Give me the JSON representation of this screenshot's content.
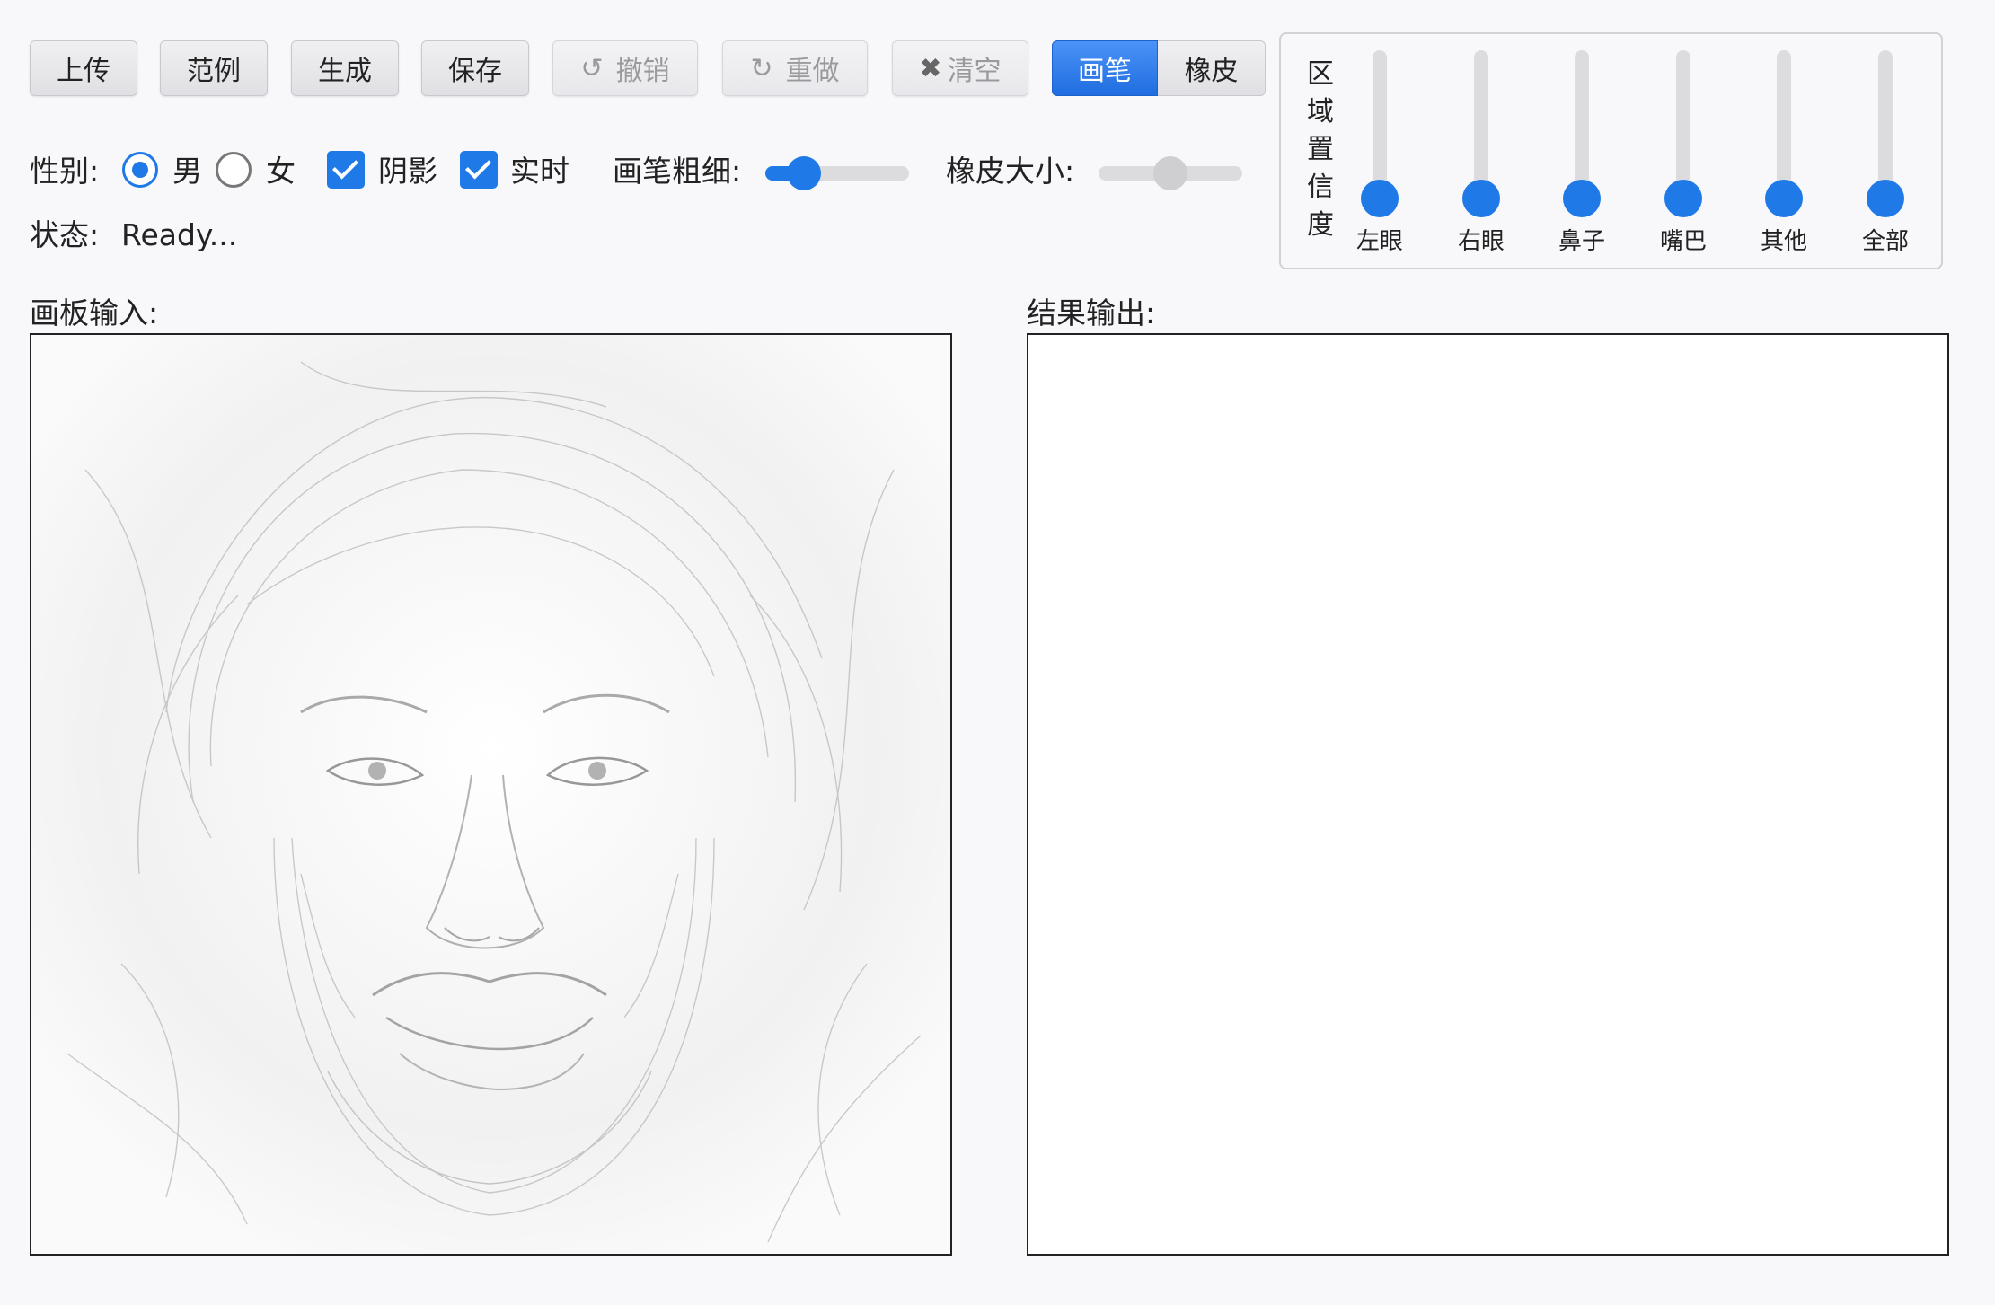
{
  "toolbar": {
    "upload": "上传",
    "examples": "范例",
    "generate": "生成",
    "save": "保存",
    "undo": "撤销",
    "redo": "重做",
    "clear": "清空",
    "brush": "画笔",
    "eraser": "橡皮"
  },
  "options": {
    "gender_label": "性别:",
    "gender_male": "男",
    "gender_female": "女",
    "gender_selected": "男",
    "shadow_label": "阴影",
    "shadow_checked": true,
    "realtime_label": "实时",
    "realtime_checked": true,
    "brush_size_label": "画笔粗细:",
    "brush_size_value": 0.2,
    "eraser_size_label": "橡皮大小:",
    "eraser_size_value": 0.5
  },
  "status": {
    "label": "状态:",
    "text": "Ready..."
  },
  "confidence": {
    "title_chars": [
      "区",
      "域",
      "置",
      "信",
      "度"
    ],
    "sliders": [
      {
        "label": "左眼",
        "value": 0
      },
      {
        "label": "右眼",
        "value": 0
      },
      {
        "label": "鼻子",
        "value": 0
      },
      {
        "label": "嘴巴",
        "value": 0
      },
      {
        "label": "其他",
        "value": 0
      },
      {
        "label": "全部",
        "value": 0
      }
    ]
  },
  "input_panel": {
    "label": "画板输入:"
  },
  "output_panel": {
    "label": "结果输出:"
  },
  "colors": {
    "accent": "#1f7ae8",
    "border": "#222222"
  }
}
